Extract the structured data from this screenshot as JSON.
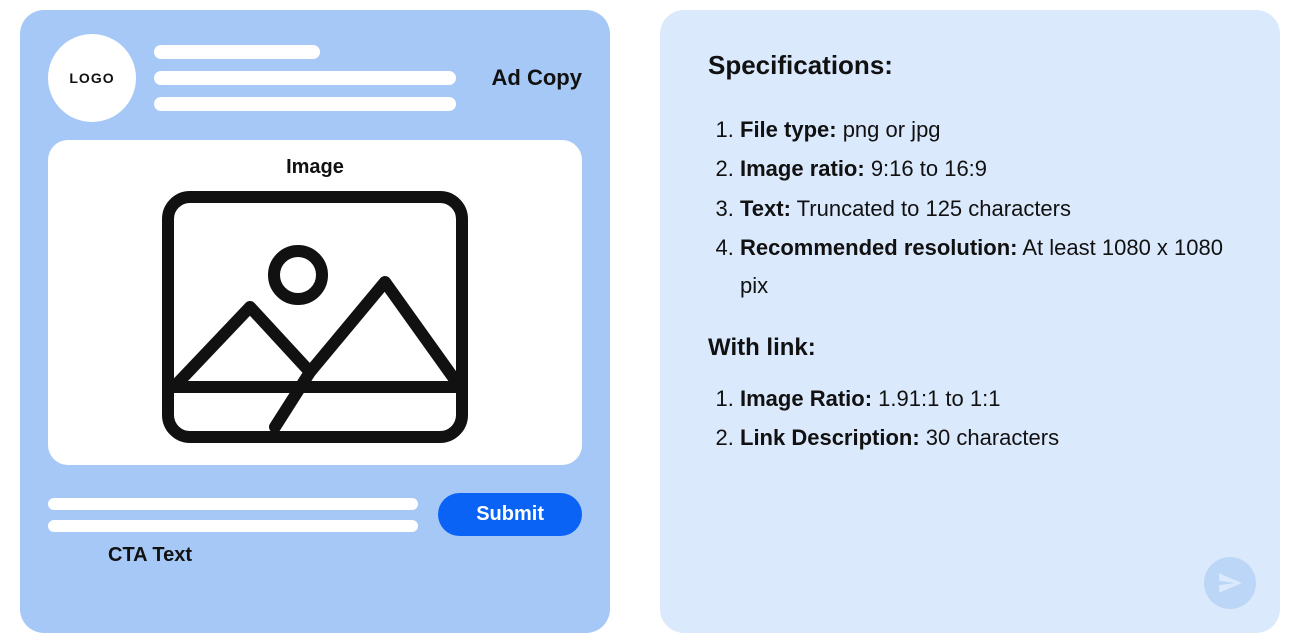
{
  "mockup": {
    "logo_text": "LOGO",
    "ad_copy_label": "Ad Copy",
    "image_label": "Image",
    "submit_label": "Submit",
    "cta_label": "CTA Text"
  },
  "specs": {
    "title": "Specifications:",
    "items": [
      {
        "label": "File type:",
        "value": " png or jpg"
      },
      {
        "label": "Image ratio:",
        "value": " 9:16 to 16:9"
      },
      {
        "label": "Text:",
        "value": " Truncated to 125 characters"
      },
      {
        "label": "Recommended resolution:",
        "value": " At least 1080 x 1080 pix"
      }
    ],
    "withlink_title": "With link:",
    "withlink_items": [
      {
        "label": "Image Ratio:",
        "value": " 1.91:1 to 1:1"
      },
      {
        "label": "Link Description:",
        "value": " 30 characters"
      }
    ]
  }
}
